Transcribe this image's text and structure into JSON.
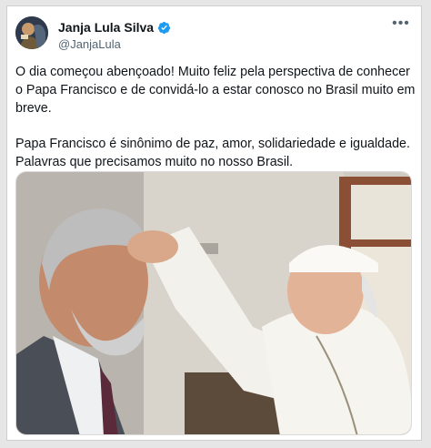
{
  "author": {
    "display_name": "Janja Lula Silva",
    "handle": "@JanjaLula",
    "verified": true,
    "avatar_icon": "avatar-photo"
  },
  "tweet": {
    "paragraphs": [
      "O dia começou abençoado! Muito feliz pela perspectiva de conhecer o Papa Francisco e de convidá-lo a estar conosco no Brasil muito em breve.",
      "Papa Francisco é sinônimo de paz, amor, solidariedade e igualdade. Palavras que precisamos muito no nosso Brasil."
    ],
    "more_icon": "more-options-icon"
  },
  "colors": {
    "verified_blue": "#1d9bf0",
    "text": "#0f1419",
    "secondary_text": "#536471"
  },
  "media": {
    "type": "photo",
    "icon": "photo-image"
  }
}
